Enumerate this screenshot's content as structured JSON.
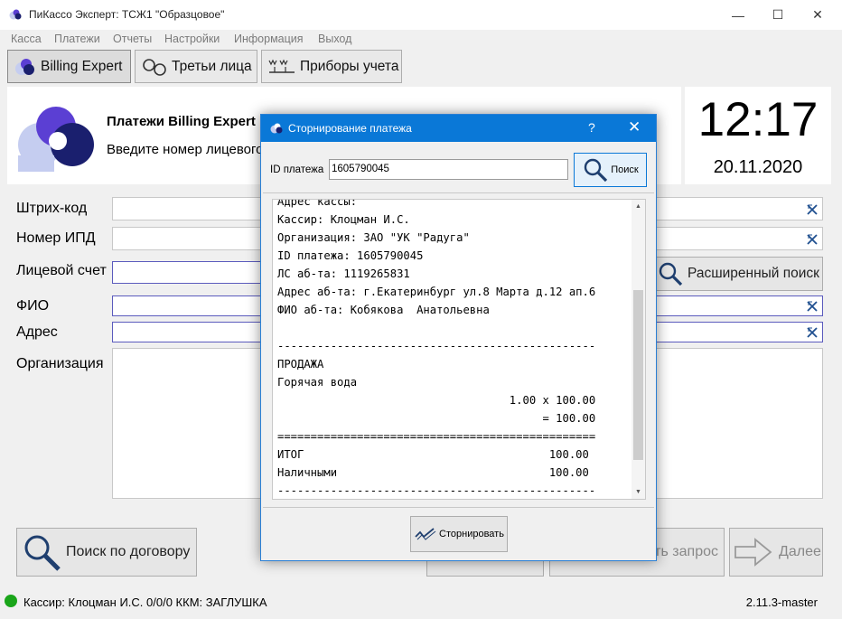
{
  "window": {
    "title": "ПиКассо Эксперт: ТСЖ1 \"Образцовое\"",
    "min_glyph": "—",
    "max_glyph": "☐",
    "close_glyph": "✕"
  },
  "menu": [
    "Касса",
    "Платежи",
    "Отчеты",
    "Настройки",
    "Информация",
    "Выход"
  ],
  "toolbar": {
    "billing": "Billing Expert",
    "third_party": "Третьи лица",
    "meters": "Приборы учета"
  },
  "header": {
    "title": "Платежи Billing Expert",
    "subtitle": "Введите номер лицевого счета"
  },
  "clock": {
    "time": "12:17",
    "date": "20.11.2020"
  },
  "form": {
    "barcode_label": "Штрих-код",
    "ipd_label": "Номер ИПД",
    "account_label": "Лицевой счет",
    "fio_label": "ФИО",
    "address_label": "Адрес",
    "org_label": "Организация",
    "extended_search": "Расширенный поиск"
  },
  "bottom": {
    "contract_search": "Поиск по договору",
    "request_partial": "ть запрос",
    "next": "Далее"
  },
  "status": {
    "text": "Кассир: Клоцман И.С. 0/0/0  ККМ: ЗАГЛУШКА",
    "version": "2.11.3-master"
  },
  "dialog": {
    "title": "Сторнирование платежа",
    "help": "?",
    "close": "✕",
    "id_label": "ID платежа",
    "id_value": "1605790045",
    "search_label": "Поиск",
    "reverse_label": "Сторнировать",
    "receipt_lines": [
      "Адрес кассы:",
      "Кассир: Клоцман И.С.",
      "Организация: ЗАО \"УК \"Радуга\"",
      "ID платежа: 1605790045",
      "ЛС аб-та: 1119265831",
      "Адрес аб-та: г.Екатеринбург ул.8 Марта д.12 ап.6",
      "ФИО аб-та: Кобякова  Анатольевна",
      "",
      "------------------------------------------------",
      "ПРОДАЖА",
      "Горячая вода",
      "                                   1.00 x 100.00",
      "                                        = 100.00",
      "================================================",
      "ИТОГ                                     100.00",
      "Наличными                                100.00",
      "------------------------------------------------"
    ]
  },
  "colors": {
    "accent_blue": "#0a78d7",
    "logo_purple": "#5b3fd3",
    "logo_navy": "#1a1f6e",
    "logo_light": "#c5cdf0",
    "status_green": "#1aa51a"
  }
}
